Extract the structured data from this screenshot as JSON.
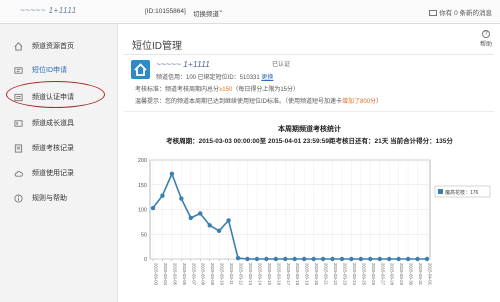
{
  "topbar": {
    "handle": "~~~~~ 1+1111",
    "id_text": "[ID:10155864]",
    "switch_text": "切换频道",
    "caret": "⌄",
    "messages": "你有 0 条新的消息"
  },
  "sidebar": {
    "items": [
      {
        "label": "频道资源首页",
        "icon": "home-icon"
      },
      {
        "label": "短位ID申请",
        "icon": "id-card-icon"
      },
      {
        "label": "频道认证申请",
        "icon": "verify-icon"
      },
      {
        "label": "频道成长道具",
        "icon": "growth-icon"
      },
      {
        "label": "频道考核记录",
        "icon": "record-icon"
      },
      {
        "label": "频道使用记录",
        "icon": "cloud-icon"
      },
      {
        "label": "规则与帮助",
        "icon": "help-icon"
      }
    ]
  },
  "main": {
    "title": "短位ID管理",
    "help": "帮助",
    "handle": "~~~~~ 1+1111",
    "auth": "已认证",
    "info1_a": "频道信用：100  已绑定短位ID：510331  ",
    "info1_link": "更换",
    "info2_a": "考核标准：频道考核周期内总分",
    "info2_b": "≥150",
    "info2_c": "（每日得分上限为15分）",
    "info3_a": "温馨提示：您的频道本周期已达到继续使用短位ID标准。（使用频道短号加速卡",
    "info3_b": "增加了800分",
    "info3_c": "）"
  },
  "chart_data": {
    "type": "line",
    "title": "本周期频道考核统计",
    "subtitle": "考核周期：2015-03-03 00:00:00至 2015-04-01 23:59:59距考核日还有：21天  当前合计得分：135分",
    "legend": "魔高花枝：176",
    "legend_position": "top-right",
    "ylim": [
      0,
      200
    ],
    "yticks": [
      0,
      50,
      100,
      150,
      200
    ],
    "grid": true,
    "color": "#3a7fb0",
    "x": [
      "2015-03-03",
      "2015-03-04",
      "2015-03-05",
      "2015-03-06",
      "2015-03-07",
      "2015-03-08",
      "2015-03-09",
      "2015-03-10",
      "2015-03-11",
      "2015-03-12",
      "2015-03-13",
      "2015-03-14",
      "2015-03-15",
      "2015-03-16",
      "2015-03-17",
      "2015-03-18",
      "2015-03-19",
      "2015-03-20",
      "2015-03-21",
      "2015-03-22",
      "2015-03-23",
      "2015-03-24",
      "2015-03-25",
      "2015-03-26",
      "2015-03-27",
      "2015-03-28",
      "2015-03-29",
      "2015-03-30",
      "2015-03-31",
      "2015-04-01"
    ],
    "values": [
      103,
      128,
      172,
      122,
      83,
      92,
      68,
      57,
      78,
      2,
      0,
      0,
      0,
      0,
      0,
      0,
      0,
      0,
      0,
      0,
      0,
      0,
      0,
      0,
      0,
      0,
      0,
      0,
      0,
      0
    ]
  }
}
